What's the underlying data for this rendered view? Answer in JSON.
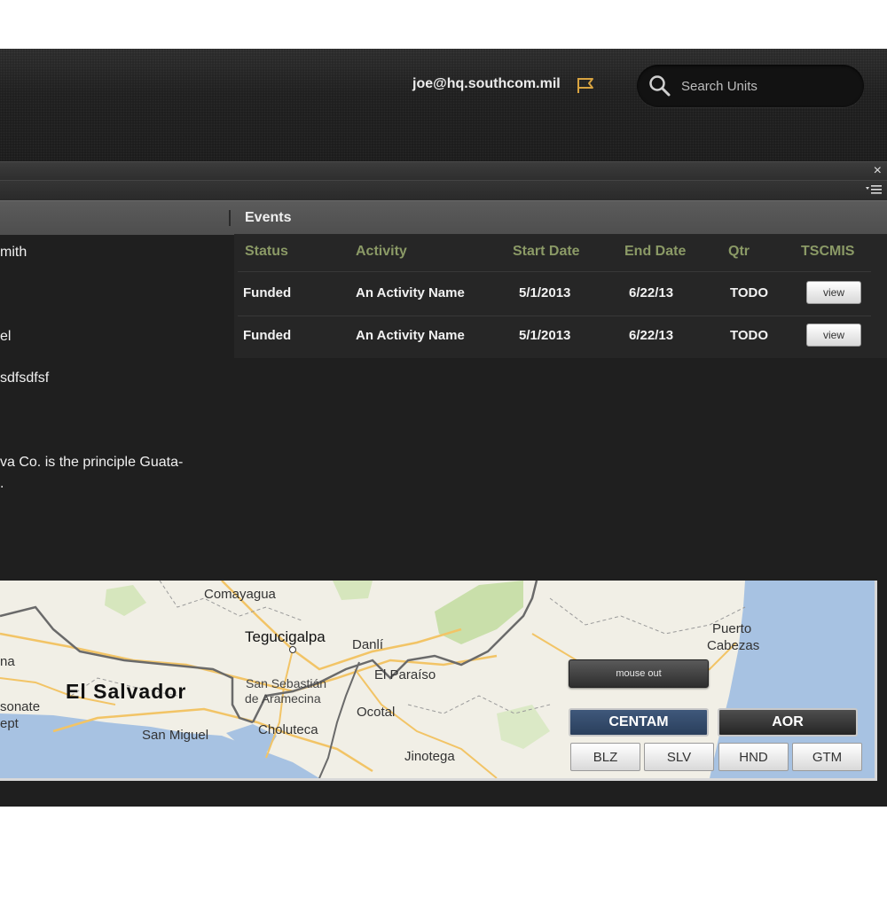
{
  "header": {
    "user_email": "joe@hq.southcom.mil",
    "search_placeholder": "Search Units",
    "flag_color": "#d9a441"
  },
  "panel": {
    "close_symbol": "×",
    "left_column": {
      "lines": [
        "mith",
        "el",
        "sdfsdfsf",
        "va Co. is the principle Guata-",
        "."
      ]
    },
    "events": {
      "heading": "Events",
      "columns": [
        "Status",
        "Activity",
        "Start Date",
        "End Date",
        "Qtr",
        "TSCMIS"
      ],
      "rows": [
        {
          "status": "Funded",
          "activity": "An Activity Name",
          "start_date": "5/1/2013",
          "end_date": "6/22/13",
          "qtr": "TODO",
          "action": "view"
        },
        {
          "status": "Funded",
          "activity": "An Activity Name",
          "start_date": "5/1/2013",
          "end_date": "6/22/13",
          "qtr": "TODO",
          "action": "view"
        }
      ],
      "header_color": "#8b9a66"
    }
  },
  "map": {
    "labels": {
      "comayagua": "Comayagua",
      "tegucigalpa": "Tegucigalpa",
      "danli": "Danlí",
      "el_paraiso": "El Paraíso",
      "san_sebastian": "San Sebastián",
      "de_aramecina": "de Aramecina",
      "ocotal": "Ocotal",
      "choluteca": "Choluteca",
      "san_miguel": "San Miguel",
      "el_salvador": "El Salvador",
      "na": "na",
      "sonate": "sonate",
      "ept": "ept",
      "jinotega": "Jinotega",
      "puerto": "Puerto",
      "cabezas": "Cabezas"
    },
    "controls": {
      "mouse_out": "mouse out",
      "centam": "CENTAM",
      "aor": "AOR",
      "countries": [
        "BLZ",
        "SLV",
        "HND",
        "GTM"
      ]
    },
    "colors": {
      "land": "#f1efe6",
      "water": "#a7c2e2",
      "road": "#f2c466",
      "border": "#666666",
      "forest": "#c9dfaa"
    }
  }
}
